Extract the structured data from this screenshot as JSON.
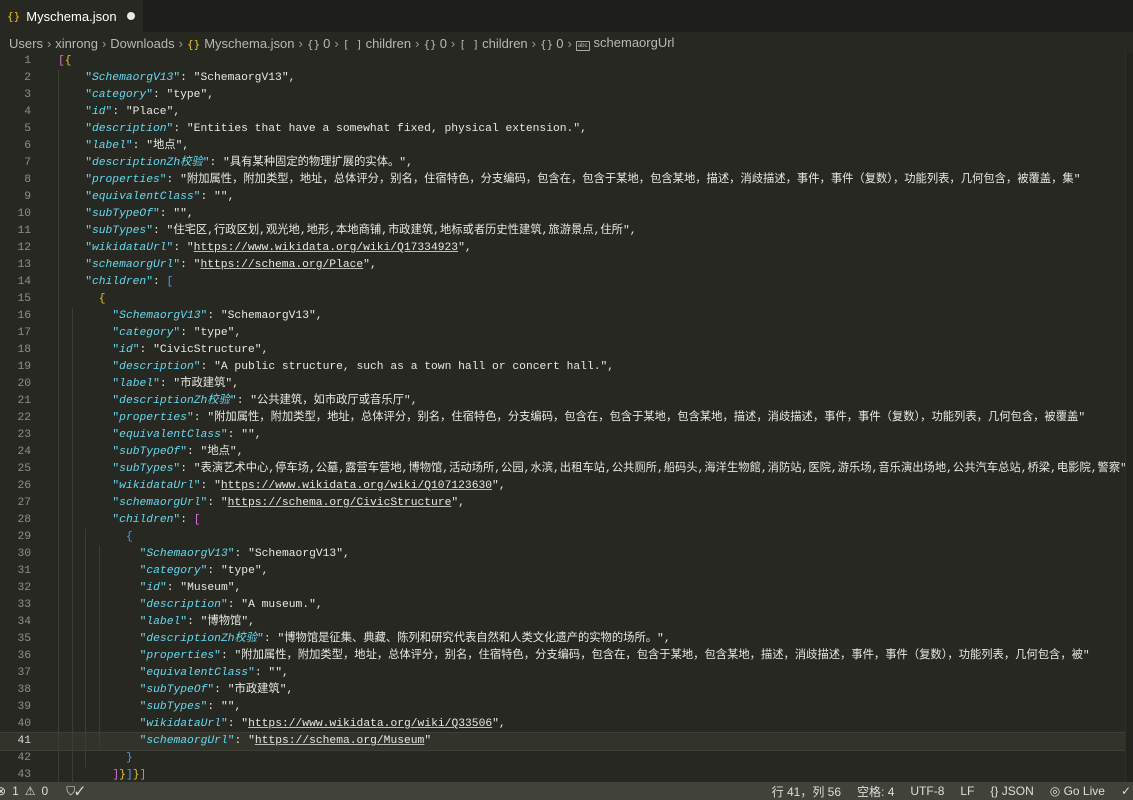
{
  "tab": {
    "title": "Myschema.json",
    "icon": "json-braces-icon",
    "modified": true
  },
  "breadcrumb": [
    {
      "label": "Users",
      "icon": ""
    },
    {
      "label": "xinrong",
      "icon": ""
    },
    {
      "label": "Downloads",
      "icon": ""
    },
    {
      "label": "Myschema.json",
      "icon": "json-braces-icon"
    },
    {
      "label": "0",
      "icon": "object-icon"
    },
    {
      "label": "children",
      "icon": "array-icon"
    },
    {
      "label": "0",
      "icon": "object-icon"
    },
    {
      "label": "children",
      "icon": "array-icon"
    },
    {
      "label": "0",
      "icon": "object-icon"
    },
    {
      "label": "schemaorgUrl",
      "icon": "string-icon"
    }
  ],
  "colors": {
    "background": "#272822",
    "key": "#66d9ef",
    "string": "#e8e8e2",
    "bracket_magenta": "#d670d6",
    "bracket_yellow": "#e6c62d",
    "bracket_blue": "#4a9ef0"
  },
  "editor": {
    "current_line": 41,
    "lines": [
      {
        "n": "1",
        "indent": 0,
        "brackets": [
          [
            "[",
            "#d670d6"
          ],
          [
            "{",
            "#e6c62d"
          ]
        ]
      },
      {
        "n": "2",
        "indent": 4,
        "key": "SchemaorgV13",
        "value": "SchemaorgV13",
        "comma": true
      },
      {
        "n": "3",
        "indent": 4,
        "key": "category",
        "value": "type",
        "comma": true
      },
      {
        "n": "4",
        "indent": 4,
        "key": "id",
        "value": "Place",
        "comma": true
      },
      {
        "n": "5",
        "indent": 4,
        "key": "description",
        "value": "Entities that have a somewhat fixed, physical extension.",
        "comma": true
      },
      {
        "n": "6",
        "indent": 4,
        "key": "label",
        "value": "地点",
        "comma": true
      },
      {
        "n": "7",
        "indent": 4,
        "key": "descriptionZh校验",
        "value": "具有某种固定的物理扩展的实体。",
        "comma": true
      },
      {
        "n": "8",
        "indent": 4,
        "key": "properties",
        "value": "附加属性，附加类型，地址，总体评分，别名，住宿特色，分支编码，包含在，包含于某地，包含某地，描述，消歧描述，事件，事件（复数），功能列表，几何包含，被覆盖，集",
        "comma": false
      },
      {
        "n": "9",
        "indent": 4,
        "key": "equivalentClass",
        "value": "",
        "comma": true
      },
      {
        "n": "10",
        "indent": 4,
        "key": "subTypeOf",
        "value": "",
        "comma": true
      },
      {
        "n": "11",
        "indent": 4,
        "key": "subTypes",
        "value": "住宅区,行政区划,观光地,地形,本地商铺,市政建筑,地标或者历史性建筑,旅游景点,住所",
        "comma": true
      },
      {
        "n": "12",
        "indent": 4,
        "key": "wikidataUrl",
        "value": "https://www.wikidata.org/wiki/Q17334923",
        "url": true,
        "comma": true
      },
      {
        "n": "13",
        "indent": 4,
        "key": "schemaorgUrl",
        "value": "https://schema.org/Place",
        "url": true,
        "comma": true
      },
      {
        "n": "14",
        "indent": 4,
        "key": "children",
        "open": [
          "[",
          "#4a9ef0"
        ]
      },
      {
        "n": "15",
        "indent": 6,
        "brackets": [
          [
            "{",
            "#e6c62d"
          ]
        ]
      },
      {
        "n": "16",
        "indent": 8,
        "key": "SchemaorgV13",
        "value": "SchemaorgV13",
        "comma": true
      },
      {
        "n": "17",
        "indent": 8,
        "key": "category",
        "value": "type",
        "comma": true
      },
      {
        "n": "18",
        "indent": 8,
        "key": "id",
        "value": "CivicStructure",
        "comma": true
      },
      {
        "n": "19",
        "indent": 8,
        "key": "description",
        "value": "A public structure, such as a town hall or concert hall.",
        "comma": true
      },
      {
        "n": "20",
        "indent": 8,
        "key": "label",
        "value": "市政建筑",
        "comma": true
      },
      {
        "n": "21",
        "indent": 8,
        "key": "descriptionZh校验",
        "value": "公共建筑，如市政厅或音乐厅",
        "comma": true
      },
      {
        "n": "22",
        "indent": 8,
        "key": "properties",
        "value": "附加属性，附加类型，地址，总体评分，别名，住宿特色，分支编码，包含在，包含于某地，包含某地，描述，消歧描述，事件，事件（复数），功能列表，几何包含，被覆盖",
        "comma": false
      },
      {
        "n": "23",
        "indent": 8,
        "key": "equivalentClass",
        "value": "",
        "comma": true
      },
      {
        "n": "24",
        "indent": 8,
        "key": "subTypeOf",
        "value": "地点",
        "comma": true
      },
      {
        "n": "25",
        "indent": 8,
        "key": "subTypes",
        "value": "表演艺术中心,停车场,公墓,露营车营地,博物馆,活动场所,公园,水滨,出租车站,公共厕所,船码头,海洋生物館,消防站,医院,游乐场,音乐演出场地,公共汽车总站,桥梁,电影院,警察",
        "comma": false
      },
      {
        "n": "26",
        "indent": 8,
        "key": "wikidataUrl",
        "value": "https://www.wikidata.org/wiki/Q107123630",
        "url": true,
        "comma": true
      },
      {
        "n": "27",
        "indent": 8,
        "key": "schemaorgUrl",
        "value": "https://schema.org/CivicStructure",
        "url": true,
        "comma": true
      },
      {
        "n": "28",
        "indent": 8,
        "key": "children",
        "open": [
          "[",
          "#d670d6"
        ]
      },
      {
        "n": "29",
        "indent": 10,
        "brackets": [
          [
            "{",
            "#4a9ef0"
          ]
        ]
      },
      {
        "n": "30",
        "indent": 12,
        "key": "SchemaorgV13",
        "value": "SchemaorgV13",
        "comma": true
      },
      {
        "n": "31",
        "indent": 12,
        "key": "category",
        "value": "type",
        "comma": true
      },
      {
        "n": "32",
        "indent": 12,
        "key": "id",
        "value": "Museum",
        "comma": true
      },
      {
        "n": "33",
        "indent": 12,
        "key": "description",
        "value": "A museum.",
        "comma": true
      },
      {
        "n": "34",
        "indent": 12,
        "key": "label",
        "value": "博物馆",
        "comma": true
      },
      {
        "n": "35",
        "indent": 12,
        "key": "descriptionZh校验",
        "value": "博物馆是征集、典藏、陈列和研究代表自然和人类文化遗产的实物的场所。",
        "comma": true
      },
      {
        "n": "36",
        "indent": 12,
        "key": "properties",
        "value": "附加属性，附加类型，地址，总体评分，别名，住宿特色，分支编码，包含在，包含于某地，包含某地，描述，消歧描述，事件，事件（复数），功能列表，几何包含，被",
        "comma": false
      },
      {
        "n": "37",
        "indent": 12,
        "key": "equivalentClass",
        "value": "",
        "comma": true
      },
      {
        "n": "38",
        "indent": 12,
        "key": "subTypeOf",
        "value": "市政建筑",
        "comma": true
      },
      {
        "n": "39",
        "indent": 12,
        "key": "subTypes",
        "value": "",
        "comma": true
      },
      {
        "n": "40",
        "indent": 12,
        "key": "wikidataUrl",
        "value": "https://www.wikidata.org/wiki/Q33506",
        "url": true,
        "comma": true
      },
      {
        "n": "41",
        "indent": 12,
        "key": "schemaorgUrl",
        "value": "https://schema.org/Museum",
        "url": true,
        "comma": false
      },
      {
        "n": "42",
        "indent": 10,
        "brackets": [
          [
            "}",
            "#4a9ef0"
          ]
        ]
      },
      {
        "n": "43",
        "indent": 8,
        "brackets": [
          [
            "]",
            "#d670d6"
          ],
          [
            "}",
            "#e6c62d"
          ],
          [
            "]",
            "#4a9ef0"
          ],
          [
            "}",
            "#e6c62d"
          ],
          [
            "]",
            "#d670d6"
          ]
        ]
      }
    ]
  },
  "statusbar": {
    "errors": "1",
    "warnings": "0",
    "position": "行 41，列 56",
    "spaces": "空格: 4",
    "encoding": "UTF-8",
    "eol": "LF",
    "language": "JSON",
    "golive": "Go Live"
  }
}
